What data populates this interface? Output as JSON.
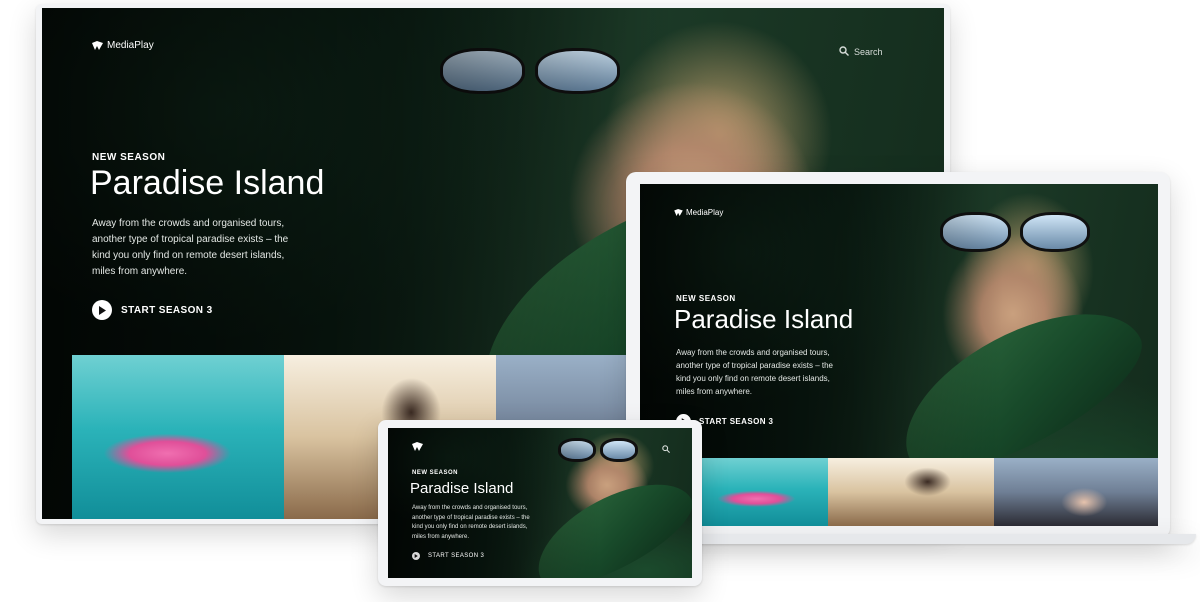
{
  "brand": {
    "name": "MediaPlay"
  },
  "search": {
    "label": "Search"
  },
  "hero": {
    "eyebrow": "NEW SEASON",
    "title": "Paradise Island",
    "description": "Away from the crowds and organised tours, another type of tropical paradise exists – the kind you only find on remote desert islands, miles from anywhere.",
    "cta_label": "START SEASON 3"
  },
  "thumbnails": [
    "flamingo-pool-image",
    "motorbike-rider-image",
    "hair-styling-image"
  ],
  "colors": {
    "page_background": "#ffffff",
    "bezel": "#f3f4f6",
    "text_primary": "#ffffff",
    "accent_leaf": "#184a2a"
  }
}
